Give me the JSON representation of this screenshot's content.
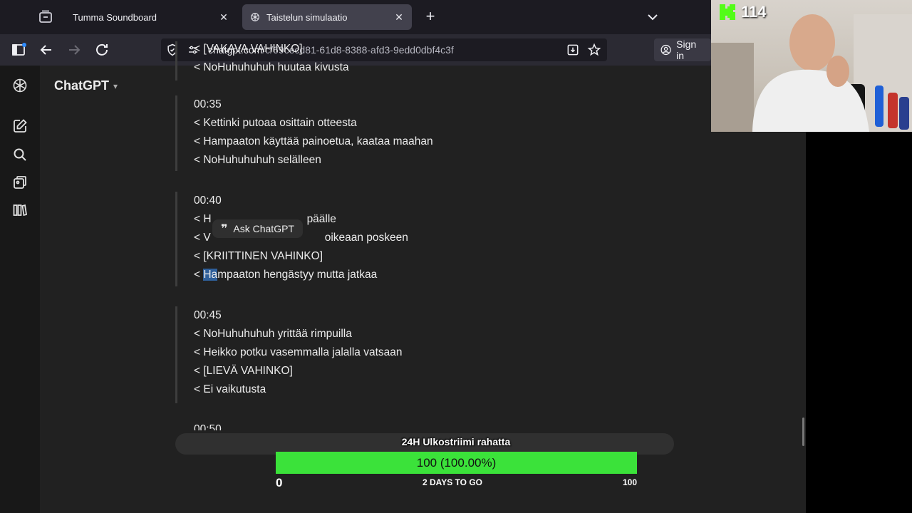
{
  "browser": {
    "tabs": [
      {
        "title": "Tumma Soundboard",
        "active": false
      },
      {
        "title": "Taistelun simulaatio",
        "active": true
      }
    ],
    "url_main": "chatgpt.com",
    "url_path": "/c/69cecd81-61d8-8388-afd3-9edd0dbf4c3f",
    "sign_in": "Sign in"
  },
  "app": {
    "model_name": "ChatGPT",
    "rail_icons": [
      "chatgpt-logo-icon",
      "new-chat-icon",
      "search-icon",
      "images-icon",
      "library-icon"
    ]
  },
  "transcript": {
    "block1": [
      "< [VAKAVA VAHINKO]",
      "< NoHuhuhuhuh huutaa kivusta"
    ],
    "block2": {
      "time": "00:35",
      "lines": [
        "< Kettinki putoaa osittain otteesta",
        "< Hampaaton käyttää painoetua, kaataa maahan",
        "< NoHuhuhuhuh selälleen"
      ]
    },
    "block3": {
      "time": "00:40",
      "line1": "< H",
      "line1b": "päälle",
      "line2a": "< V",
      "line2b": "oikeaan poskeen",
      "line3": "< [KRIITTINEN VAHINKO]",
      "line4a": "< ",
      "line4hl": "Ha",
      "line4b": "mpaaton hengästyy mutta jatkaa"
    },
    "block4": {
      "time": "00:45",
      "lines": [
        "< NoHuhuhuhuh yrittää rimpuilla",
        "< Heikko potku vasemmalla jalalla vatsaan",
        "< [LIEVÄ VAHINKO]",
        "< Ei vaikutusta"
      ]
    },
    "next_time": "00:50"
  },
  "popup": {
    "label": "Ask ChatGPT"
  },
  "goal": {
    "title": "24H Ulkostriimi rahatta",
    "value_text": "100 (100.00%)",
    "progress": 1.0,
    "min": "0",
    "days": "2 DAYS TO GO",
    "max": "100"
  },
  "webcam": {
    "viewer_count": "114"
  },
  "colors": {
    "accent": "#53fc18",
    "goal_bar": "#3be23a",
    "app_bg": "#212121"
  }
}
